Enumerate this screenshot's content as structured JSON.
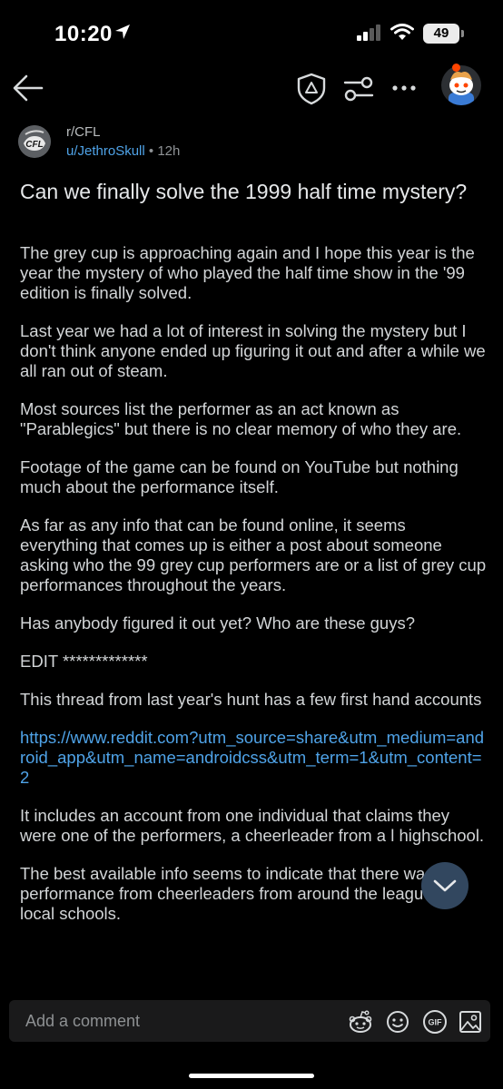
{
  "status_bar": {
    "time": "10:20",
    "battery": "49",
    "icons": [
      "location-arrow-icon",
      "cellular-signal-icon",
      "wifi-icon",
      "battery-icon"
    ]
  },
  "nav": {
    "icons": [
      "back-arrow-icon",
      "mod-shield-icon",
      "filter-sliders-icon",
      "more-dots-icon",
      "user-avatar"
    ]
  },
  "post": {
    "subreddit": "r/CFL",
    "subreddit_icon_text": "CFL",
    "author": "u/JethroSkull",
    "separator": "•",
    "age": "12h",
    "title": "Can we finally solve the 1999 half time mystery?",
    "paragraphs": [
      "The grey cup is approaching again and I hope this year is the year the mystery of who played the half time show in the '99 edition is finally solved.",
      "Last year we had a lot of interest in solving the mystery but I don't think anyone ended up figuring it out and after a while we all ran out of steam.",
      "Most sources list the performer as an act known as \"Parablegics\" but there is no clear memory of who they are.",
      "Footage of the game can be found on YouTube but nothing much about the performance itself.",
      "As far as any info that can be found online, it seems everything that comes up is either a post about someone asking who the 99 grey cup performers are or a list of grey cup performances throughout the years.",
      "Has anybody figured it out yet? Who are these guys?",
      "EDIT *************",
      "This thread from last year's hunt has a few first hand accounts"
    ],
    "link": "https://www.reddit.com?utm_source=share&utm_medium=android_app&utm_name=androidcss&utm_term=1&utm_content=2",
    "paragraphs_after_link": [
      "It includes an account from one individual that claims they were one of the performers, a cheerleader from a l highschool.",
      "The best available info seems to indicate that there was a performance from cheerleaders from around the league and local schools."
    ]
  },
  "comment_bar": {
    "placeholder": "Add a comment",
    "gif_label": "GIF",
    "icons": [
      "snoo-icon",
      "emoji-icon",
      "gif-icon",
      "image-icon"
    ]
  },
  "colors": {
    "background": "#000000",
    "link": "#4fa3e8",
    "scroll_button": "#32475f"
  }
}
